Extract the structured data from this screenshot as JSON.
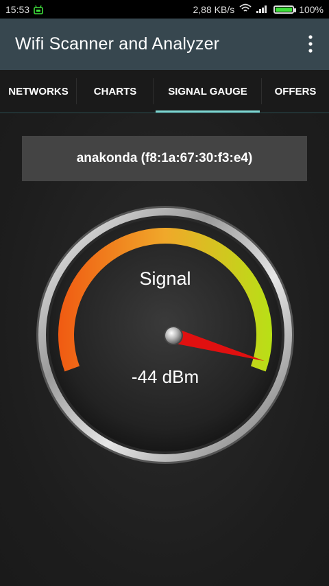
{
  "status_bar": {
    "time": "15:53",
    "speed": "2,88 KB/s",
    "battery": "100%",
    "battery_level": 1.0
  },
  "app_bar": {
    "title": "Wifi Scanner and Analyzer",
    "menu_icon": "overflow-menu-icon"
  },
  "tabs": [
    {
      "label": "NETWORKS",
      "active": false
    },
    {
      "label": "CHARTS",
      "active": false
    },
    {
      "label": "SIGNAL GAUGE",
      "active": true
    },
    {
      "label": "OFFERS",
      "active": false
    }
  ],
  "network": {
    "label": "anakonda (f8:1a:67:30:f3:e4)"
  },
  "gauge": {
    "title": "Signal",
    "reading": "-44 dBm",
    "level": 0.98,
    "colors": {
      "low": "#f05a12",
      "mid": "#f0a82a",
      "high": "#b8e016",
      "needle": "#e01010"
    }
  }
}
